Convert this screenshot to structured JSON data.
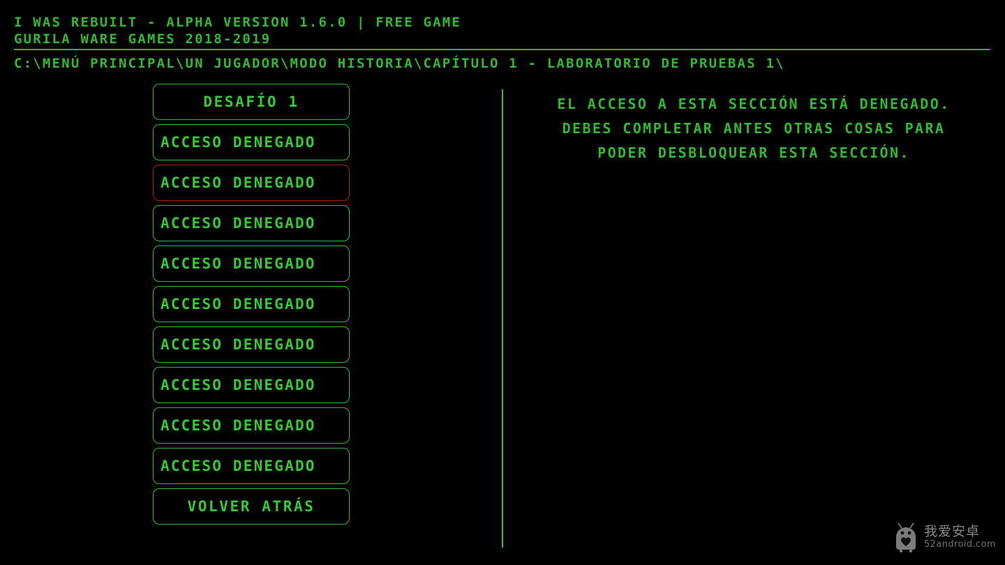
{
  "header": {
    "line1": "I WAS REBUILT - ALPHA VERSION 1.6.0 | FREE GAME",
    "line2": "GURILA WARE GAMES 2018-2019",
    "breadcrumb": "C:\\MENÚ PRINCIPAL\\UN JUGADOR\\MODO HISTORIA\\CAPÍTULO 1 - LABORATORIO DE PRUEBAS 1\\"
  },
  "menu": {
    "items": [
      {
        "label": "DESAFÍO 1",
        "state": "unlocked",
        "align": "centered",
        "selected": false
      },
      {
        "label": "ACCESO DENEGADO",
        "state": "locked",
        "align": "locked",
        "selected": false
      },
      {
        "label": "ACCESO DENEGADO",
        "state": "locked",
        "align": "locked",
        "selected": true
      },
      {
        "label": "ACCESO DENEGADO",
        "state": "locked",
        "align": "locked",
        "selected": false
      },
      {
        "label": "ACCESO DENEGADO",
        "state": "locked",
        "align": "locked",
        "selected": false
      },
      {
        "label": "ACCESO DENEGADO",
        "state": "locked",
        "align": "locked",
        "selected": false
      },
      {
        "label": "ACCESO DENEGADO",
        "state": "locked",
        "align": "locked",
        "selected": false
      },
      {
        "label": "ACCESO DENEGADO",
        "state": "locked",
        "align": "locked",
        "selected": false
      },
      {
        "label": "ACCESO DENEGADO",
        "state": "locked",
        "align": "locked",
        "selected": false
      },
      {
        "label": "ACCESO DENEGADO",
        "state": "locked",
        "align": "locked",
        "selected": false
      },
      {
        "label": "VOLVER ATRÁS",
        "state": "unlocked",
        "align": "centered",
        "selected": false
      }
    ]
  },
  "info_panel": {
    "lines": [
      "EL ACCESO A ESTA SECCIÓN ESTÁ DENEGADO.",
      "DEBES COMPLETAR ANTES OTRAS COSAS PARA",
      "PODER DESBLOQUEAR ESTA SECCIÓN."
    ]
  },
  "watermark": {
    "icon": "android-robot-icon",
    "chinese": "我爱安卓",
    "url": "52android.com"
  },
  "colors": {
    "background": "#000000",
    "terminal_green": "#2fbb2f",
    "text_green": "#33cc33",
    "selected_red": "#a52222",
    "watermark_gray": "#d9d9d9"
  }
}
